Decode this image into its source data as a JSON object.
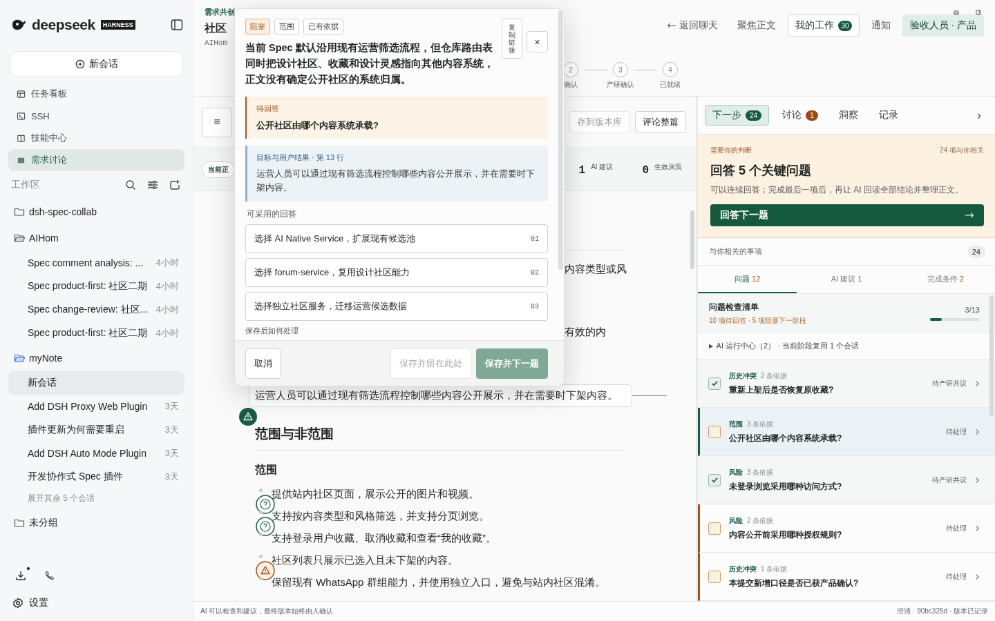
{
  "sidebar": {
    "logo": "deepseek",
    "badge": "HARNESS",
    "new_chat": "新会话",
    "nav": [
      {
        "label": "任务看板",
        "selected": false
      },
      {
        "label": "SSH",
        "selected": false
      },
      {
        "label": "技能中心",
        "selected": false
      },
      {
        "label": "需求讨论",
        "selected": true
      }
    ],
    "workspace_label": "工作区",
    "tree": [
      {
        "label": "dsh-spec-collab",
        "expanded": false,
        "current": false
      },
      {
        "label": "AIHom",
        "expanded": true,
        "current": false,
        "children": [
          {
            "label": "Spec comment analysis: ...",
            "time": "4小时",
            "selected": false
          },
          {
            "label": "Spec product-first: 社区二期",
            "time": "4小时",
            "selected": false
          },
          {
            "label": "Spec change-review: 社区...",
            "time": "4小时",
            "selected": false
          },
          {
            "label": "Spec product-first: 社区二期",
            "time": "4小时",
            "selected": false
          }
        ]
      },
      {
        "label": "myNote",
        "expanded": true,
        "current": true,
        "more": "展开其余 5 个会话",
        "children": [
          {
            "label": "新会话",
            "selected": true
          },
          {
            "label": "Add DSH Proxy Web Plugin",
            "time": "3天",
            "selected": false
          },
          {
            "label": "插件更新为何需要重启",
            "time": "3天",
            "selected": false
          },
          {
            "label": "Add DSH Auto Mode Plugin",
            "time": "3天",
            "selected": false
          },
          {
            "label": "开发协作式 Spec 插件",
            "time": "3天",
            "selected": false
          }
        ]
      },
      {
        "label": "未分组",
        "expanded": false,
        "current": false
      }
    ],
    "download_badge": true,
    "settings": "设置"
  },
  "header": {
    "breadcrumb": "需求共创",
    "title": "社区",
    "subtitle": "AIHom",
    "nav": [
      {
        "label": "返回聊天",
        "kind": "back"
      },
      {
        "label": "聚焦正文",
        "kind": "link"
      },
      {
        "label": "我的工作",
        "kind": "outlined",
        "count": "30"
      },
      {
        "label": "通知",
        "kind": "link"
      },
      {
        "label": "验收人员 · 产品",
        "kind": "filled"
      }
    ],
    "steps": [
      {
        "number": "2",
        "label": "确认"
      },
      {
        "number": "3",
        "label": "产研确认"
      },
      {
        "number": "4",
        "label": "已就绪"
      }
    ]
  },
  "toolbar": {
    "menu": "≡",
    "save": "存到版本库",
    "comment": "评论整篇",
    "chip": "当前正",
    "stats": [
      {
        "value": "1",
        "label": "AI 建议"
      },
      {
        "value": "0",
        "label": "生效决策"
      }
    ]
  },
  "document": {
    "fragments": [
      "内容类型或风",
      "有效的内"
    ],
    "quote": "运营人员可以通过现有筛选流程控制哪些内容公开展示，并在需要时下架内容。",
    "heading": "范围与非范围",
    "subheading": "范围",
    "bullets": [
      {
        "text": "提供站内社区页面，展示公开的图片和视频。",
        "kind": "question"
      },
      {
        "text": "支持按内容类型和风格筛选，并支持分页浏览。",
        "kind": "question"
      },
      {
        "text": "支持登录用户收藏、取消收藏和查看“我的收藏”。",
        "kind": "plain"
      },
      {
        "text": "社区列表只展示已选入且未下架的内容。",
        "kind": "warning"
      },
      {
        "text": "保留现有 WhatsApp 群组能力，并使用独立入口，避免与站内社区混淆。",
        "kind": "plain"
      }
    ]
  },
  "dialog": {
    "tags": [
      {
        "label": "阻塞",
        "kind": "blocker"
      },
      {
        "label": "范围",
        "kind": "plain"
      },
      {
        "label": "已有依据",
        "kind": "plain"
      }
    ],
    "question": "当前 Spec 默认沿用现有运营筛选流程，但仓库路由表同时把设计社区、收藏和设计灵感指向其他内容系统，正文没有确定公开社区的系统归属。",
    "copy_link": "复制链接",
    "close": "×",
    "pending": {
      "label": "待回答",
      "question": "公开社区由哪个内容系统承载?"
    },
    "source": {
      "ref": "目标与用户结果 · 第 13 行",
      "text": "运营人员可以通过现有筛选流程控制哪些内容公开展示，并在需要时下架内容。"
    },
    "options_label": "可采用的回答",
    "options": [
      {
        "text": "选择 AI Native Service，扩展现有候选池",
        "number": "01"
      },
      {
        "text": "选择 forum-service，复用设计社区能力",
        "number": "02"
      },
      {
        "text": "选择独立社区服务，迁移运营候选数据",
        "number": "03"
      }
    ],
    "after_label": "保存后如何处理",
    "cancel": "取消",
    "stay": {
      "label": "保存并留在此处",
      "disabled": true
    },
    "next": {
      "label": "保存并下一题",
      "disabled": true
    }
  },
  "panel": {
    "tabs": [
      {
        "label": "下一步",
        "count": "24",
        "color": "#155a3e",
        "selected": true
      },
      {
        "label": "讨论",
        "count": "1",
        "color": "#9a4a17",
        "selected": false
      },
      {
        "label": "洞察",
        "selected": false
      },
      {
        "label": "记录",
        "selected": false
      }
    ],
    "more": "›",
    "card": {
      "eyebrow": "需要你的判断",
      "meta": "24 项与你相关",
      "title": "回答 5 个关键问题",
      "text": "可以连续回答；完成最后一项后，再让 AI 回读全部结论并整理正文。",
      "button": "回答下一题"
    },
    "related": {
      "label": "与你相关的事项",
      "count": "24"
    },
    "subtabs": [
      {
        "label": "问题",
        "count": "12",
        "selected": true
      },
      {
        "label": "AI 建议",
        "count": "1",
        "selected": false
      },
      {
        "label": "完成条件",
        "count": "2",
        "selected": false
      }
    ],
    "checklist": {
      "title": "问题检查清单",
      "subtitle": "10 项待回答 · 5 项阻塞下一阶段",
      "progress": "3/13",
      "level": 0.23
    },
    "runs": {
      "toggle": "▶",
      "label": "AI 运行中心（2）",
      "note": "· 当前阶段复用 1 个会话"
    },
    "issues": [
      {
        "tag": "历史冲突",
        "evidence": "2 条依据",
        "title": "重新上架后是否恢复原收藏?",
        "status": "待产研共议",
        "checked": true,
        "selected": false
      },
      {
        "tag": "范围",
        "evidence": "3 条依据",
        "title": "公开社区由哪个内容系统承载?",
        "status": "待处理",
        "checked": false,
        "selected": true
      },
      {
        "tag": "风险",
        "evidence": "3 条依据",
        "title": "未登录浏览采用哪种访问方式?",
        "status": "待产研共议",
        "checked": true,
        "selected": false
      },
      {
        "tag": "风险",
        "evidence": "2 条依据",
        "title": "内容公开前采用哪种授权规则?",
        "status": "待处理",
        "checked": false,
        "selected": false
      },
      {
        "tag": "历史冲突",
        "evidence": "1 条依据",
        "title": "本提交新增口径是否已获产品确认?",
        "status": "待处理",
        "checked": false,
        "selected": false
      }
    ]
  },
  "status_bar": {
    "left": "AI 可以检查和建议，最终版本始终由人确认",
    "right": "澄清 · 90bc325d · 版本已记录"
  }
}
